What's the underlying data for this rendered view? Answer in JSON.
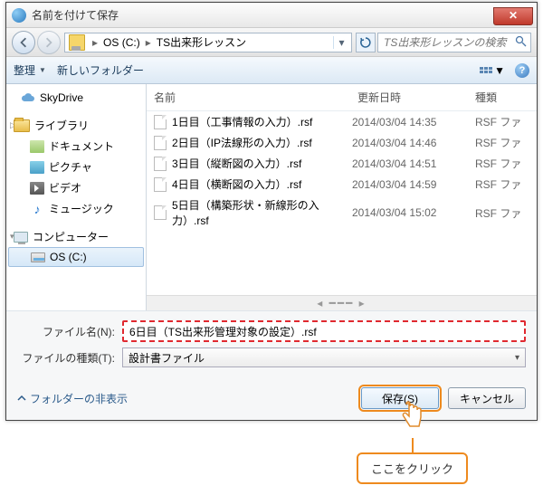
{
  "title": "名前を付けて保存",
  "breadcrumb": {
    "drive": "OS (C:)",
    "folder": "TS出来形レッスン"
  },
  "search": {
    "placeholder": "TS出来形レッスンの検索"
  },
  "toolbar": {
    "organize": "整理",
    "new_folder": "新しいフォルダー"
  },
  "tree": {
    "skydrive": "SkyDrive",
    "library": "ライブラリ",
    "documents": "ドキュメント",
    "pictures": "ピクチャ",
    "videos": "ビデオ",
    "music": "ミュージック",
    "computer": "コンピューター",
    "os_drive": "OS (C:)"
  },
  "columns": {
    "name": "名前",
    "date": "更新日時",
    "type": "種類"
  },
  "files": [
    {
      "name": "1日目（工事情報の入力）.rsf",
      "date": "2014/03/04 14:35",
      "type": "RSF ファ"
    },
    {
      "name": "2日目（IP法線形の入力）.rsf",
      "date": "2014/03/04 14:46",
      "type": "RSF ファ"
    },
    {
      "name": "3日目（縦断図の入力）.rsf",
      "date": "2014/03/04 14:51",
      "type": "RSF ファ"
    },
    {
      "name": "4日目（横断図の入力）.rsf",
      "date": "2014/03/04 14:59",
      "type": "RSF ファ"
    },
    {
      "name": "5日目（構築形状・新線形の入力）.rsf",
      "date": "2014/03/04 15:02",
      "type": "RSF ファ"
    }
  ],
  "form": {
    "filename_label": "ファイル名(N):",
    "filename_value": "6日目（TS出来形管理対象の設定）.rsf",
    "filetype_label": "ファイルの種類(T):",
    "filetype_value": "設計書ファイル"
  },
  "footer": {
    "hide_folders": "フォルダーの非表示",
    "save": "保存(S)",
    "cancel": "キャンセル"
  },
  "callout": "ここをクリック"
}
